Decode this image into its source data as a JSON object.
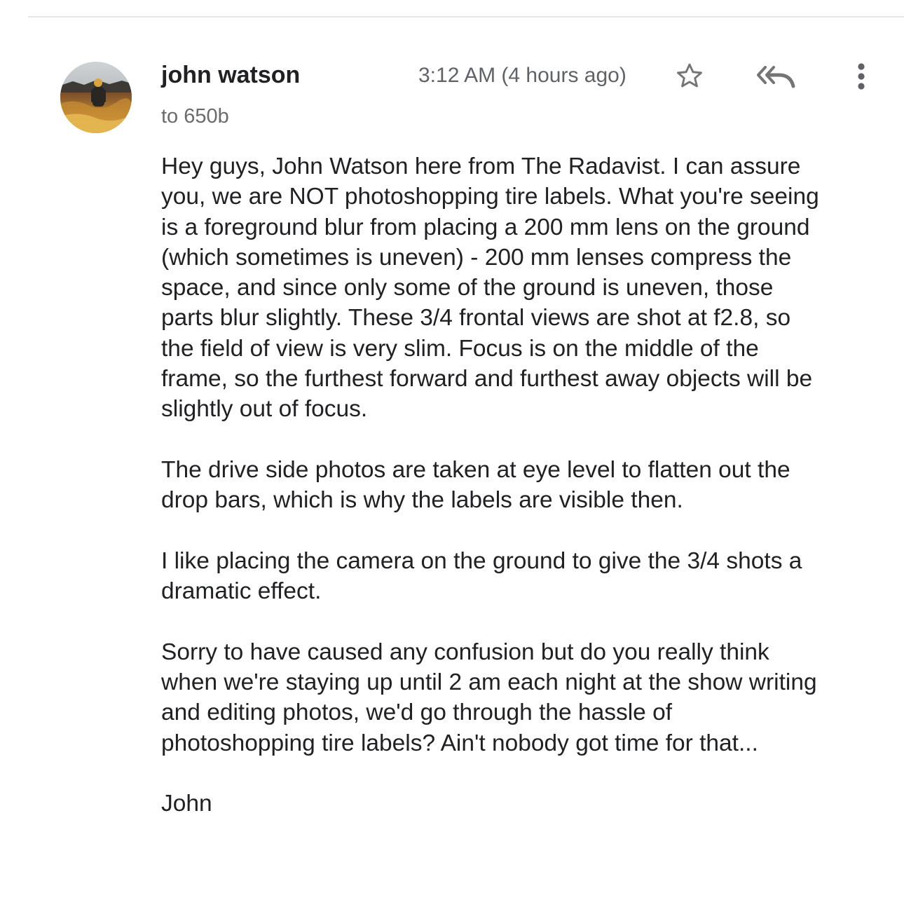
{
  "message": {
    "sender_name": "john watson",
    "recipient": "to 650b",
    "timestamp": "3:12 AM (4 hours ago)",
    "icons": {
      "avatar": "avatar-photo",
      "star": "star-outline-icon",
      "reply_all": "reply-all-icon",
      "more": "more-vertical-icon"
    },
    "body": {
      "p1": "Hey guys, John Watson here from The Radavist. I can assure\nyou, we are NOT photoshopping tire labels. What you're seeing\nis a foreground blur from placing a 200 mm lens on the ground\n(which sometimes is uneven) - 200 mm lenses compress the\nspace, and since only some of the ground is uneven, those\nparts blur slightly. These 3/4 frontal views are shot at f2.8, so\nthe field of view is very slim. Focus is on the middle of the\nframe, so the furthest forward and furthest away objects will be\nslightly out of focus.",
      "p2": "The drive side photos are taken at eye level to flatten out the\ndrop bars, which is why the labels are visible then.",
      "p3": "I like placing the camera on the ground to give the 3/4 shots a\ndramatic effect.",
      "p4": "Sorry to have caused any confusion but do you really think\nwhen we're staying up until 2 am each night at the show writing\nand editing photos, we'd go through the hassle of\nphotoshopping tire labels? Ain't nobody got time for that...",
      "signature": "John"
    }
  },
  "colors": {
    "text_primary": "#202124",
    "text_secondary": "#5f6368",
    "icon": "#757575",
    "divider": "#e6e6e6"
  }
}
